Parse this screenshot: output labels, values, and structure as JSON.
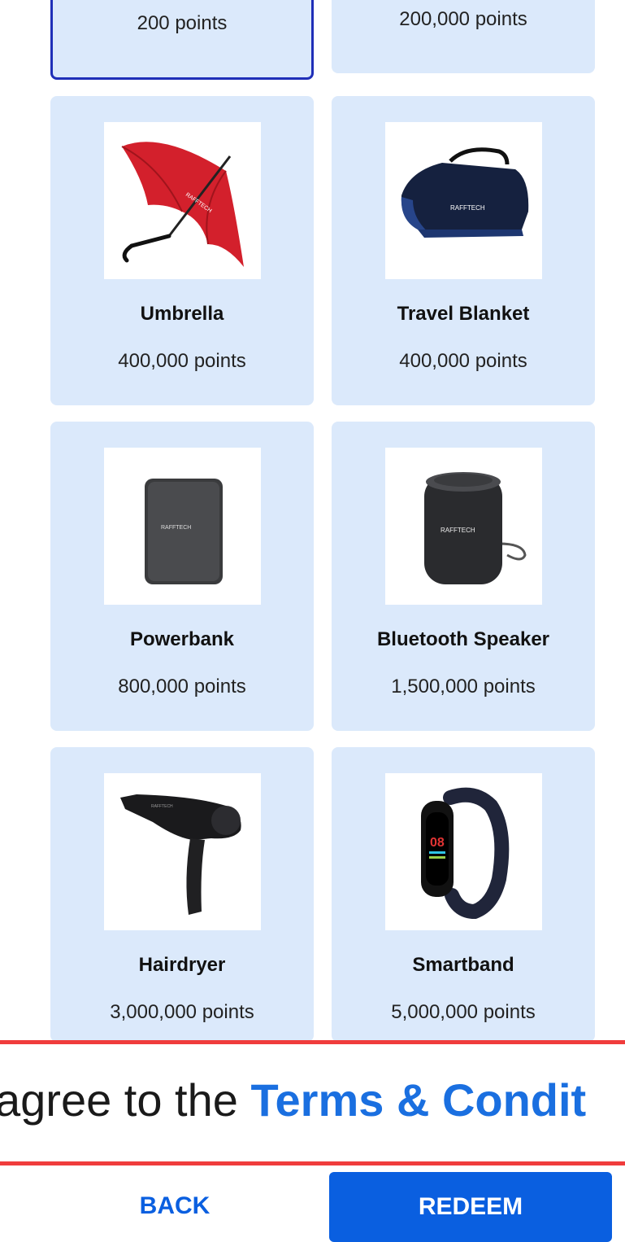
{
  "rewards": [
    {
      "id": "top-left",
      "name": "",
      "points": "200 points",
      "selected": true
    },
    {
      "id": "top-right",
      "name": "",
      "points": "200,000 points",
      "selected": false
    },
    {
      "id": "umbrella",
      "name": "Umbrella",
      "points": "400,000 points",
      "icon": "umbrella-image"
    },
    {
      "id": "travel-blanket",
      "name": "Travel Blanket",
      "points": "400,000 points",
      "icon": "travel-blanket-image"
    },
    {
      "id": "powerbank",
      "name": "Powerbank",
      "points": "800,000 points",
      "icon": "powerbank-image"
    },
    {
      "id": "bluetooth-speaker",
      "name": "Bluetooth Speaker",
      "points": "1,500,000 points",
      "icon": "bluetooth-speaker-image"
    },
    {
      "id": "hairdryer",
      "name": "Hairdryer",
      "points": "3,000,000 points",
      "icon": "hairdryer-image"
    },
    {
      "id": "smartband",
      "name": "Smartband",
      "points": "5,000,000 points",
      "icon": "smartband-image"
    }
  ],
  "brand": "RAFFTECH",
  "terms": {
    "prefix": "agree to the ",
    "link": "Terms & Condit"
  },
  "actions": {
    "back_label": "BACK",
    "redeem_label": "REDEEM"
  },
  "colors": {
    "card_bg": "#dbe9fb",
    "primary": "#0a5fe0",
    "selected_border": "#1f2fb8",
    "highlight": "#f03c3c"
  }
}
